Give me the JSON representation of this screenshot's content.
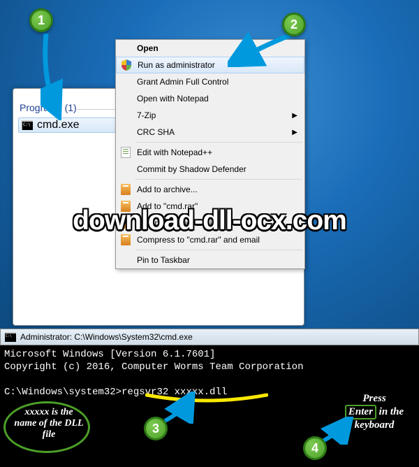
{
  "badges": {
    "b1": "1",
    "b2": "2",
    "b3": "3",
    "b4": "4"
  },
  "start": {
    "programs_label": "Programs (1)",
    "cmd_label": "cmd.exe"
  },
  "context_menu": {
    "items": [
      {
        "label": "Open"
      },
      {
        "label": "Run as administrator"
      },
      {
        "label": "Grant Admin Full Control"
      },
      {
        "label": "Open with Notepad"
      },
      {
        "label": "7-Zip"
      },
      {
        "label": "CRC SHA"
      },
      {
        "label": "Edit with Notepad++"
      },
      {
        "label": "Commit by Shadow Defender"
      },
      {
        "label": "Add to archive..."
      },
      {
        "label": "Add to \"cmd.rar\""
      },
      {
        "label": "Compress and email..."
      },
      {
        "label": "Compress to \"cmd.rar\" and email"
      },
      {
        "label": "Pin to Taskbar"
      }
    ]
  },
  "watermark": "download-dll-ocx.com",
  "cmd": {
    "title": "Administrator: C:\\Windows\\System32\\cmd.exe",
    "line1": "Microsoft Windows [Version 6.1.7601]",
    "line2": "Copyright (c) 2016, Computer Worms Team Corporation",
    "prompt": "C:\\Windows\\system32>",
    "command": "regsvr32 xxxxx.dll"
  },
  "notes": {
    "dll": "xxxxx is the name of the DLL file",
    "press": "Press",
    "enter": "Enter",
    "inkb": "in the keyboard"
  }
}
